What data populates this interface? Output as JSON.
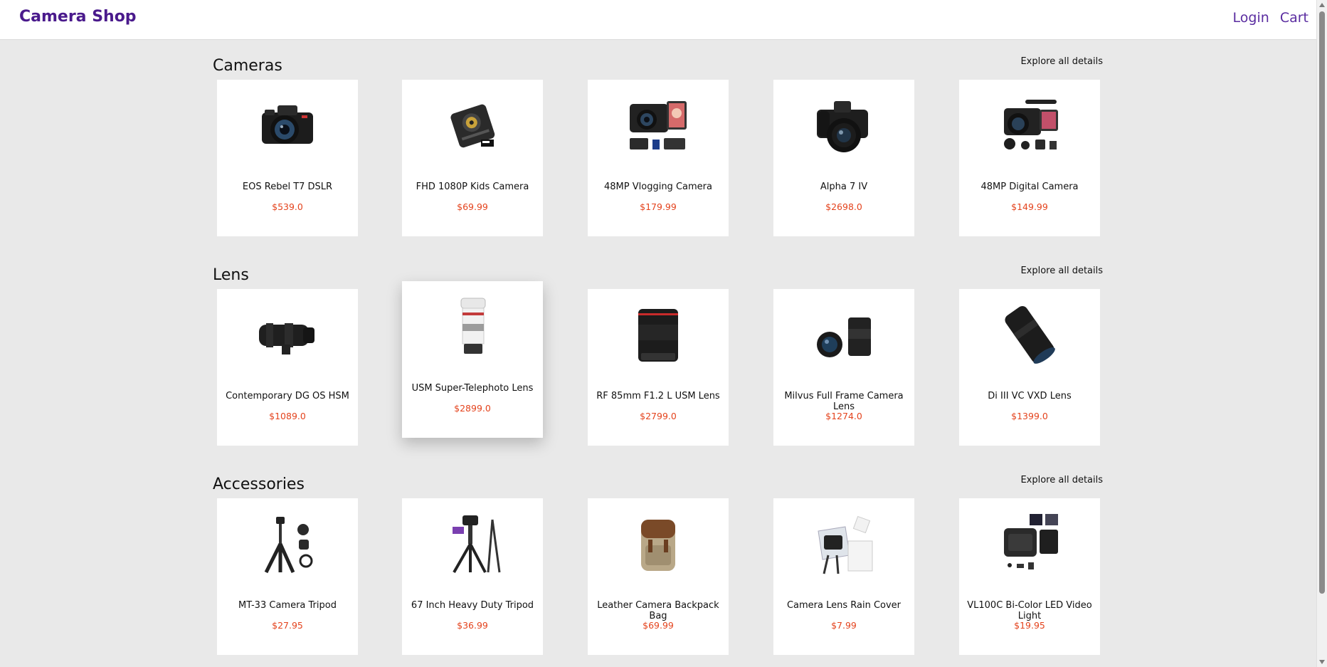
{
  "header": {
    "brand": "Camera Shop",
    "login": "Login",
    "cart": "Cart"
  },
  "explore_label": "Explore all details",
  "sections": [
    {
      "title": "Cameras",
      "products": [
        {
          "name": "EOS Rebel T7 DSLR",
          "price": "$539.0",
          "icon": "dslr-camera-icon"
        },
        {
          "name": "FHD 1080P Kids Camera",
          "price": "$69.99",
          "icon": "compact-camera-icon"
        },
        {
          "name": "48MP Vlogging Camera",
          "price": "$179.99",
          "icon": "vlogging-camera-icon"
        },
        {
          "name": "Alpha 7 IV",
          "price": "$2698.0",
          "icon": "mirrorless-camera-icon"
        },
        {
          "name": "48MP Digital Camera",
          "price": "$149.99",
          "icon": "digital-camera-kit-icon"
        }
      ]
    },
    {
      "title": "Lens",
      "products": [
        {
          "name": "Contemporary DG OS HSM",
          "price": "$1089.0",
          "icon": "zoom-lens-icon"
        },
        {
          "name": "USM Super-Telephoto Lens",
          "price": "$2899.0",
          "icon": "telephoto-lens-icon"
        },
        {
          "name": "RF 85mm F1.2 L USM Lens",
          "price": "$2799.0",
          "icon": "prime-lens-icon"
        },
        {
          "name": "Milvus Full Frame Camera Lens",
          "price": "$1274.0",
          "icon": "full-frame-lens-icon"
        },
        {
          "name": "Di III VC VXD Lens",
          "price": "$1399.0",
          "icon": "macro-lens-icon"
        }
      ]
    },
    {
      "title": "Accessories",
      "products": [
        {
          "name": "MT-33 Camera Tripod",
          "price": "$27.95",
          "icon": "mini-tripod-icon"
        },
        {
          "name": "67 Inch Heavy Duty Tripod",
          "price": "$36.99",
          "icon": "tripod-icon"
        },
        {
          "name": "Leather Camera Backpack Bag",
          "price": "$69.99",
          "icon": "backpack-icon"
        },
        {
          "name": "Camera Lens Rain Cover",
          "price": "$7.99",
          "icon": "rain-cover-icon"
        },
        {
          "name": "VL100C Bi-Color LED Video Light",
          "price": "$19.95",
          "icon": "led-light-icon"
        }
      ]
    }
  ],
  "colors": {
    "brand": "#4a1a8c",
    "link": "#5a2ca0",
    "price": "#e4431d",
    "background": "#e9e9e9"
  }
}
